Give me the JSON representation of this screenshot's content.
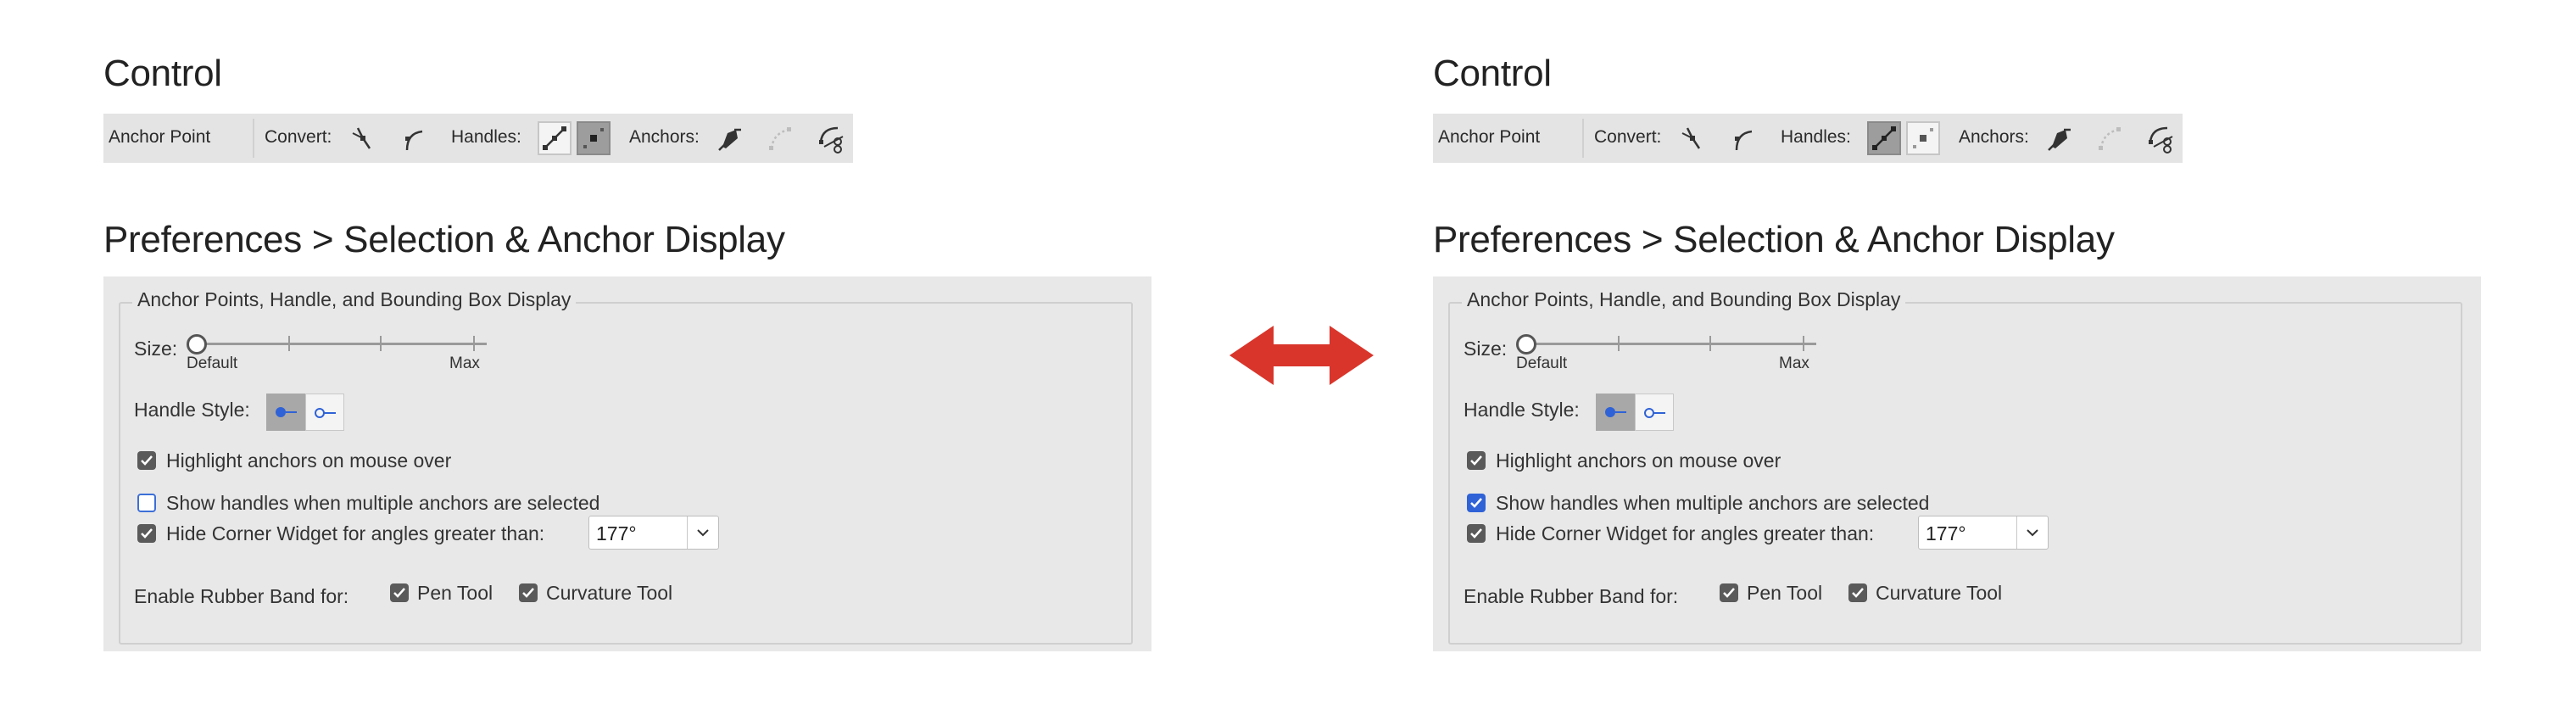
{
  "panels": [
    {
      "control_title": "Control",
      "control_bar": {
        "anchor_point_label": "Anchor Point",
        "convert_label": "Convert:",
        "handles_label": "Handles:",
        "anchors_label": "Anchors:",
        "active_handle_button": "hide-handles"
      },
      "prefs_title": "Preferences > Selection & Anchor Display",
      "group_legend": "Anchor Points, Handle, and Bounding Box Display",
      "size_label": "Size:",
      "size_min_label": "Default",
      "size_max_label": "Max",
      "handle_style_label": "Handle Style:",
      "highlight_label": "Highlight anchors on mouse over",
      "highlight_checked": true,
      "show_handles_label": "Show handles when multiple anchors are selected",
      "show_handles_checked": false,
      "hide_corner_label": "Hide Corner Widget for angles greater than:",
      "hide_corner_checked": true,
      "angle_value": "177°",
      "rubber_band_label": "Enable Rubber Band for:",
      "pen_tool_label": "Pen Tool",
      "curvature_tool_label": "Curvature Tool"
    },
    {
      "control_title": "Control",
      "control_bar": {
        "anchor_point_label": "Anchor Point",
        "convert_label": "Convert:",
        "handles_label": "Handles:",
        "anchors_label": "Anchors:",
        "active_handle_button": "show-handles"
      },
      "prefs_title": "Preferences > Selection & Anchor Display",
      "group_legend": "Anchor Points, Handle, and Bounding Box Display",
      "size_label": "Size:",
      "size_min_label": "Default",
      "size_max_label": "Max",
      "handle_style_label": "Handle Style:",
      "highlight_label": "Highlight anchors on mouse over",
      "highlight_checked": true,
      "show_handles_label": "Show handles when multiple anchors are selected",
      "show_handles_checked": true,
      "hide_corner_label": "Hide Corner Widget for angles greater than:",
      "hide_corner_checked": true,
      "angle_value": "177°",
      "rubber_band_label": "Enable Rubber Band for:",
      "pen_tool_label": "Pen Tool",
      "curvature_tool_label": "Curvature Tool"
    }
  ],
  "colors": {
    "arrow": "#d9352b",
    "checkbox_blue": "#2f62d6",
    "handle_blue": "#2f62d6"
  },
  "icons": {
    "convert_corner": "convert-to-corner-icon",
    "convert_smooth": "convert-to-smooth-icon",
    "show_handles": "show-handles-icon",
    "hide_handles": "hide-handles-icon",
    "remove_anchor": "remove-anchor-pen-icon",
    "connect_paths": "connect-paths-icon",
    "cut_path": "cut-path-scissors-icon",
    "compare": "double-headed-arrow-icon"
  }
}
